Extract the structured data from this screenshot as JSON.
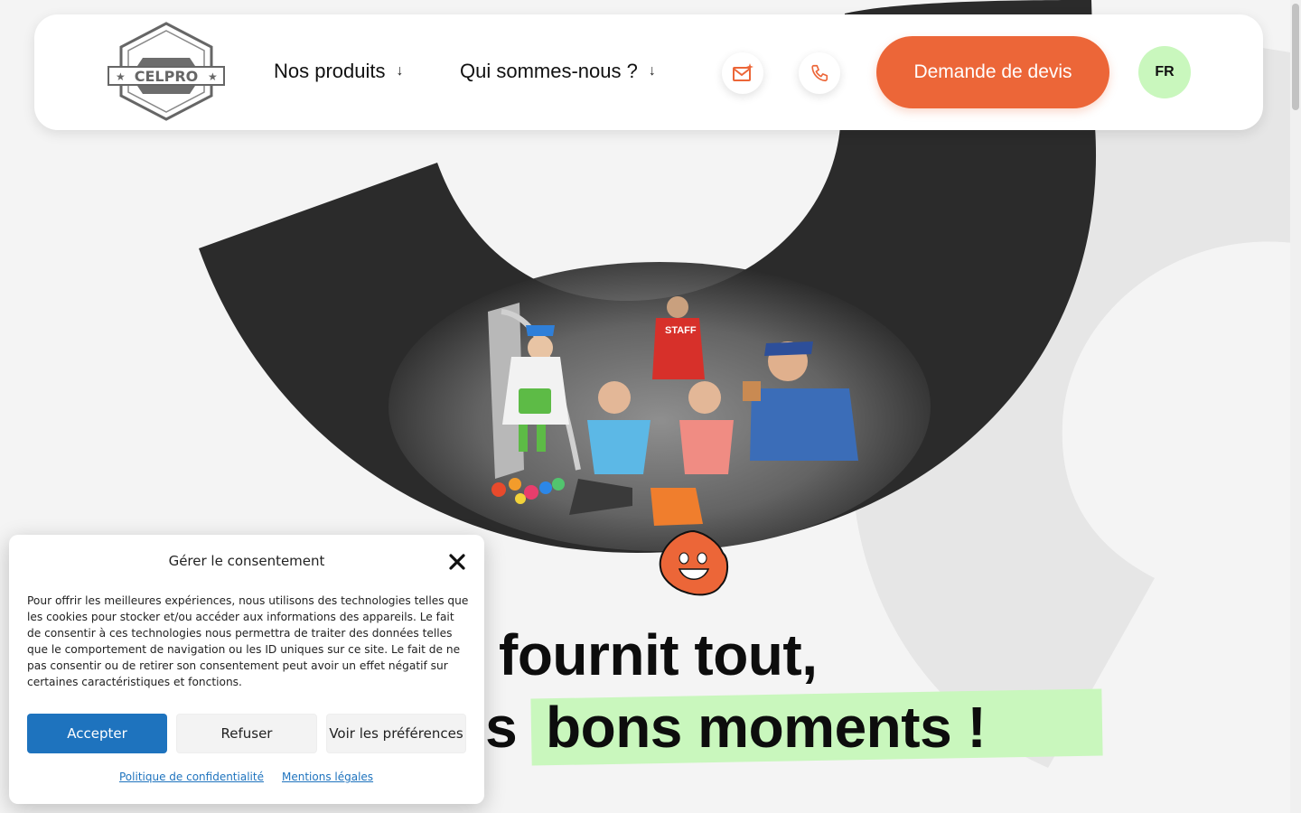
{
  "header": {
    "logo_text": "CELPRO",
    "nav": [
      {
        "label": "Nos produits",
        "arrow": "↓"
      },
      {
        "label": "Qui sommes-nous ?",
        "arrow": "↓"
      }
    ],
    "mail_icon": "mail-icon",
    "phone_icon": "phone-icon",
    "cta_label": "Demande de devis",
    "lang_label": "FR"
  },
  "hero": {
    "line1": "fournit tout,",
    "line2_partial": "es",
    "line2_highlight": "bons moments !",
    "staff_label": "STAFF"
  },
  "consent": {
    "title": "Gérer le consentement",
    "body": "Pour offrir les meilleures expériences, nous utilisons des technologies telles que les cookies pour stocker et/ou accéder aux informations des appareils. Le fait de consentir à ces technologies nous permettra de traiter des données telles que le comportement de navigation ou les ID uniques sur ce site. Le fait de ne pas consentir ou de retirer son consentement peut avoir un effet négatif sur certaines caractéristiques et fonctions.",
    "accept_label": "Accepter",
    "refuse_label": "Refuser",
    "prefs_label": "Voir les préférences",
    "privacy_link": "Politique de confidentialité",
    "legal_link": "Mentions légales"
  },
  "colors": {
    "accent": "#ec6638",
    "highlight": "#c9f7bd",
    "dark_shape": "#2b2b2b",
    "consent_primary": "#1e73be"
  }
}
